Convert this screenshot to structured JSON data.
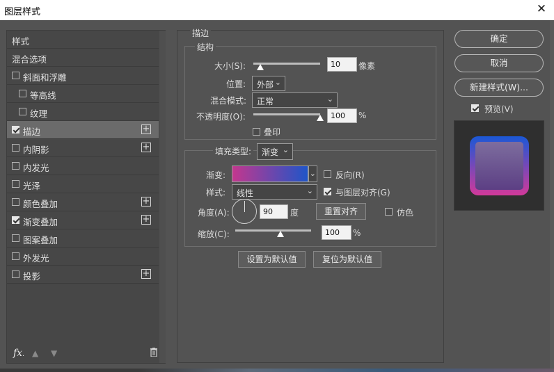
{
  "window": {
    "title": "图层样式",
    "close_icon": "close-icon"
  },
  "left_panel": {
    "items": [
      {
        "label": "样式",
        "checkbox": null,
        "indent": false,
        "plus": false,
        "selected": false
      },
      {
        "label": "混合选项",
        "checkbox": null,
        "indent": false,
        "plus": false,
        "selected": false
      },
      {
        "label": "斜面和浮雕",
        "checkbox": false,
        "indent": false,
        "plus": false,
        "selected": false
      },
      {
        "label": "等高线",
        "checkbox": false,
        "indent": true,
        "plus": false,
        "selected": false
      },
      {
        "label": "纹理",
        "checkbox": false,
        "indent": true,
        "plus": false,
        "selected": false
      },
      {
        "label": "描边",
        "checkbox": true,
        "indent": false,
        "plus": true,
        "selected": true
      },
      {
        "label": "内阴影",
        "checkbox": false,
        "indent": false,
        "plus": true,
        "selected": false
      },
      {
        "label": "内发光",
        "checkbox": false,
        "indent": false,
        "plus": false,
        "selected": false
      },
      {
        "label": "光泽",
        "checkbox": false,
        "indent": false,
        "plus": false,
        "selected": false
      },
      {
        "label": "颜色叠加",
        "checkbox": false,
        "indent": false,
        "plus": true,
        "selected": false
      },
      {
        "label": "渐变叠加",
        "checkbox": true,
        "indent": false,
        "plus": true,
        "selected": false
      },
      {
        "label": "图案叠加",
        "checkbox": false,
        "indent": false,
        "plus": false,
        "selected": false
      },
      {
        "label": "外发光",
        "checkbox": false,
        "indent": false,
        "plus": false,
        "selected": false
      },
      {
        "label": "投影",
        "checkbox": false,
        "indent": false,
        "plus": true,
        "selected": false
      }
    ],
    "fx_label": "fx",
    "fx_dot": "."
  },
  "stroke": {
    "section_title": "描边",
    "structure_title": "结构",
    "size_label": "大小(S):",
    "size_value": "10",
    "size_unit": "像素",
    "size_slider": 0.1,
    "position_label": "位置:",
    "position_value": "外部",
    "blend_label": "混合模式:",
    "blend_value": "正常",
    "opacity_label": "不透明度(O):",
    "opacity_value": "100",
    "opacity_unit": "%",
    "opacity_slider": 1.0,
    "overprint_label": "叠印",
    "overprint_checked": false,
    "fill_type_label": "填充类型:",
    "fill_type_value": "渐变",
    "gradient_label": "渐变:",
    "gradient_colors": [
      "#c3378e",
      "#1f55c8"
    ],
    "reverse_label": "反向(R)",
    "reverse_checked": false,
    "style_label": "样式:",
    "style_value": "线性",
    "align_label": "与图层对齐(G)",
    "align_checked": true,
    "angle_label": "角度(A):",
    "angle_value": "90",
    "angle_unit": "度",
    "reset_align_label": "重置对齐",
    "dither_label": "仿色",
    "dither_checked": false,
    "scale_label": "缩放(C):",
    "scale_value": "100",
    "scale_unit": "%",
    "scale_slider": 0.6,
    "set_default_label": "设置为默认值",
    "reset_default_label": "复位为默认值"
  },
  "right_panel": {
    "ok_label": "确定",
    "cancel_label": "取消",
    "new_style_label": "新建样式(W)...",
    "preview_label": "预览(V)",
    "preview_checked": true
  }
}
